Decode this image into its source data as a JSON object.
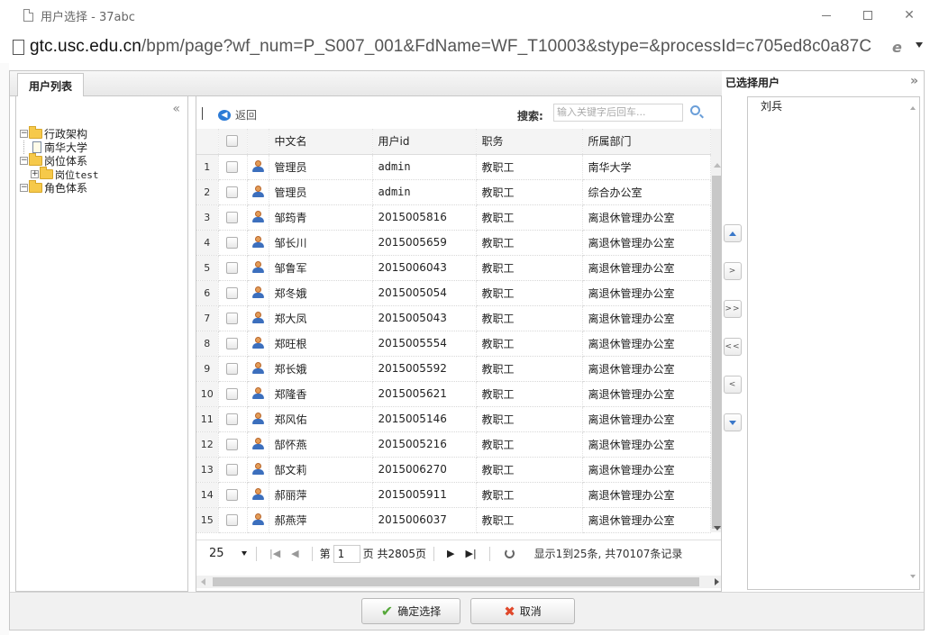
{
  "window": {
    "title": "用户选择 - 37abc",
    "url_host": "gtc.usc.edu.cn",
    "url_rest": "/bpm/page?wf_num=P_S007_001&FdName=WF_T10003&stype=&processId=c705ed8c0a87C"
  },
  "left_tab": {
    "label": "用户列表"
  },
  "tree": {
    "collapse_glyph": "«",
    "nodes": [
      {
        "label": "行政架构",
        "toggle": "−"
      },
      {
        "label": "南华大学"
      },
      {
        "label": "岗位体系",
        "toggle": "−"
      },
      {
        "label": "岗位test",
        "toggle": "+"
      },
      {
        "label": "角色体系",
        "toggle": "−"
      }
    ]
  },
  "toolbar": {
    "back_label": "返回",
    "search_label": "搜索:",
    "search_placeholder": "输入关键字后回车..."
  },
  "grid": {
    "columns": [
      "中文名",
      "用户id",
      "职务",
      "所属部门"
    ],
    "rows": [
      {
        "n": "1",
        "name": "管理员",
        "id": "admin",
        "title": "教职工",
        "dept": "南华大学"
      },
      {
        "n": "2",
        "name": "管理员",
        "id": "admin",
        "title": "教职工",
        "dept": "综合办公室"
      },
      {
        "n": "3",
        "name": "邹筠青",
        "id": "2015005816",
        "title": "教职工",
        "dept": "离退休管理办公室"
      },
      {
        "n": "4",
        "name": "邹长川",
        "id": "2015005659",
        "title": "教职工",
        "dept": "离退休管理办公室"
      },
      {
        "n": "5",
        "name": "邹鲁军",
        "id": "2015006043",
        "title": "教职工",
        "dept": "离退休管理办公室"
      },
      {
        "n": "6",
        "name": "郑冬娥",
        "id": "2015005054",
        "title": "教职工",
        "dept": "离退休管理办公室"
      },
      {
        "n": "7",
        "name": "郑大凤",
        "id": "2015005043",
        "title": "教职工",
        "dept": "离退休管理办公室"
      },
      {
        "n": "8",
        "name": "郑旺根",
        "id": "2015005554",
        "title": "教职工",
        "dept": "离退休管理办公室"
      },
      {
        "n": "9",
        "name": "郑长娥",
        "id": "2015005592",
        "title": "教职工",
        "dept": "离退休管理办公室"
      },
      {
        "n": "10",
        "name": "郑隆香",
        "id": "2015005621",
        "title": "教职工",
        "dept": "离退休管理办公室"
      },
      {
        "n": "11",
        "name": "郑风佑",
        "id": "2015005146",
        "title": "教职工",
        "dept": "离退休管理办公室"
      },
      {
        "n": "12",
        "name": "郜怀燕",
        "id": "2015005216",
        "title": "教职工",
        "dept": "离退休管理办公室"
      },
      {
        "n": "13",
        "name": "郜文莉",
        "id": "2015006270",
        "title": "教职工",
        "dept": "离退休管理办公室"
      },
      {
        "n": "14",
        "name": "郝丽萍",
        "id": "2015005911",
        "title": "教职工",
        "dept": "离退休管理办公室"
      },
      {
        "n": "15",
        "name": "郝燕萍",
        "id": "2015006037",
        "title": "教职工",
        "dept": "离退休管理办公室"
      }
    ]
  },
  "pager": {
    "page_size": "25",
    "page_prefix": "第",
    "current_page": "1",
    "page_suffix": "页 共2805页",
    "summary": "显示1到25条, 共70107条记录"
  },
  "move_buttons": [
    ">",
    ">>",
    "<<",
    "<"
  ],
  "selected_panel": {
    "title": "已选择用户",
    "expand_glyph": "»",
    "items": [
      "刘兵"
    ]
  },
  "footer": {
    "confirm_label": "确定选择",
    "cancel_label": "取消"
  }
}
